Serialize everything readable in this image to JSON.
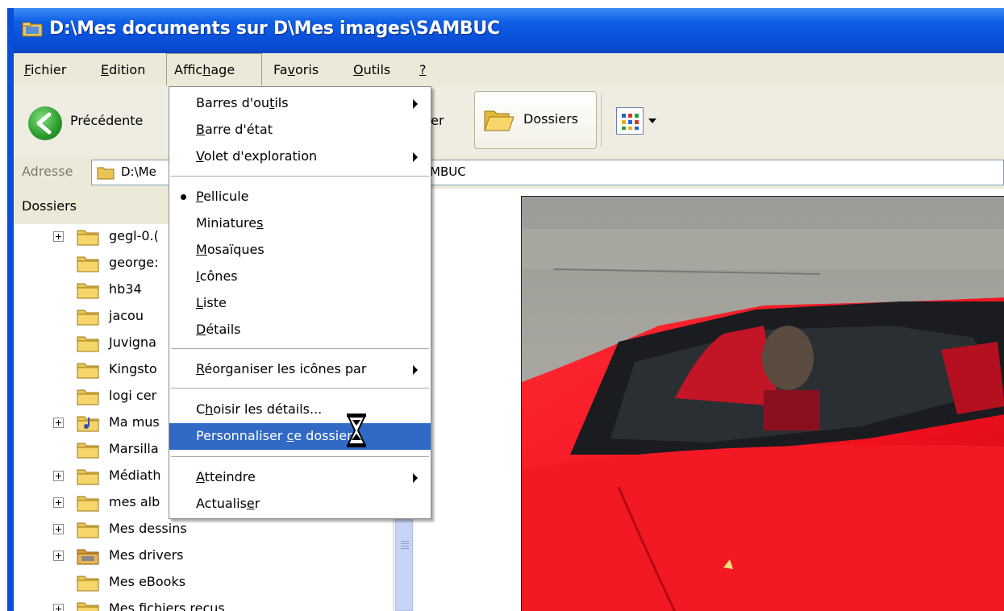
{
  "window": {
    "title": "D:\\Mes documents sur D\\Mes images\\SAMBUC"
  },
  "menubar": {
    "items": [
      {
        "label": "Fichier",
        "accel": "F",
        "rest": "ichier"
      },
      {
        "label": "Edition",
        "accel": "E",
        "rest": "dition"
      },
      {
        "label": "Affichage",
        "pre": "Affic",
        "accel": "h",
        "rest": "age"
      },
      {
        "label": "Favoris",
        "pre": "Fa",
        "accel": "v",
        "rest": "oris"
      },
      {
        "label": "Outils",
        "accel": "O",
        "rest": "utils"
      },
      {
        "label": "?",
        "accel": "?",
        "rest": ""
      }
    ]
  },
  "toolbar": {
    "back_label": "Précédente",
    "search_label_visible": "her",
    "folders_label": "Dossiers"
  },
  "address": {
    "label": "Adresse",
    "value_left": "D:\\Me",
    "value_right": "MBUC"
  },
  "pane": {
    "title": "Dossiers",
    "items": [
      {
        "label": "gegl-0.(",
        "expandable": true
      },
      {
        "label": "george:",
        "expandable": false
      },
      {
        "label": "hb34",
        "expandable": false
      },
      {
        "label": "jacou",
        "expandable": false
      },
      {
        "label": "Juvigna",
        "expandable": false
      },
      {
        "label": "Kingsto",
        "expandable": false
      },
      {
        "label": "logi cer",
        "expandable": false
      },
      {
        "label": "Ma mus",
        "expandable": true
      },
      {
        "label": "Marsilla",
        "expandable": false
      },
      {
        "label": "Médiath",
        "expandable": true
      },
      {
        "label": "mes alb",
        "expandable": true
      },
      {
        "label": "Mes dessins",
        "expandable": true
      },
      {
        "label": "Mes drivers",
        "expandable": true
      },
      {
        "label": "Mes eBooks",
        "expandable": false
      },
      {
        "label": "Mes fichiers recus",
        "expandable": true
      }
    ]
  },
  "dropdown": {
    "items": [
      {
        "pre": "Barres d'ou",
        "accel": "t",
        "rest": "ils",
        "submenu": true
      },
      {
        "pre": "",
        "accel": "B",
        "rest": "arre d'état",
        "submenu": false
      },
      {
        "pre": "",
        "accel": "V",
        "rest": "olet d'exploration",
        "submenu": true
      },
      {
        "pre": "",
        "accel": "P",
        "rest": "ellicule",
        "selected": true
      },
      {
        "pre": "Miniature",
        "accel": "s",
        "rest": ""
      },
      {
        "pre": "",
        "accel": "M",
        "rest": "osaïques"
      },
      {
        "pre": "",
        "accel": "I",
        "rest": "cônes"
      },
      {
        "pre": "",
        "accel": "L",
        "rest": "iste"
      },
      {
        "pre": "",
        "accel": "D",
        "rest": "étails"
      },
      {
        "pre": "",
        "accel": "R",
        "rest": "éorganiser les icônes par",
        "submenu": true
      },
      {
        "pre": "C",
        "accel": "h",
        "rest": "oisir les détails..."
      },
      {
        "pre": "Personnaliser ",
        "accel": "c",
        "rest": "e dossier...",
        "highlighted": true
      },
      {
        "pre": "",
        "accel": "A",
        "rest": "tteindre",
        "submenu": true
      },
      {
        "pre": "Actualis",
        "accel": "e",
        "rest": "r"
      }
    ]
  },
  "colors": {
    "titlebar": "#0a4fd8",
    "menu_highlight": "#316ac5",
    "chrome": "#ece9d8"
  },
  "icons": {
    "title": "explorer-folder-icon",
    "back": "back-arrow-icon",
    "folders": "folders-icon",
    "views": "views-grid-icon",
    "cursor": "hourglass-icon"
  }
}
